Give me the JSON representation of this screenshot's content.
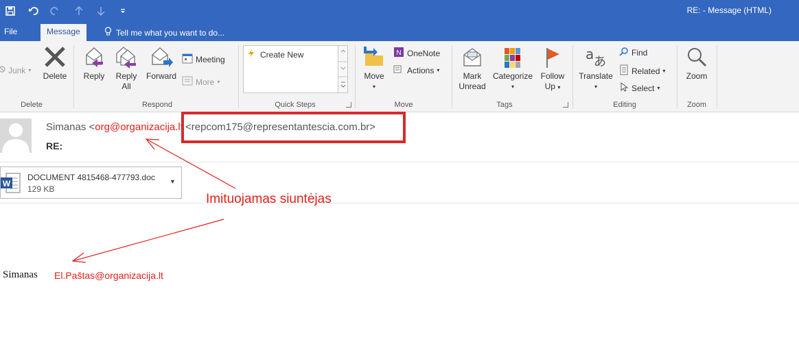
{
  "window": {
    "title": "RE:  - Message (HTML)"
  },
  "tabs": {
    "file": "File",
    "message": "Message",
    "tell_me": "Tell me what you want to do..."
  },
  "ribbon": {
    "delete_group": {
      "junk": "Junk",
      "delete": "Delete",
      "label": "Delete"
    },
    "respond_group": {
      "reply": "Reply",
      "reply_all_line1": "Reply",
      "reply_all_line2": "All",
      "forward": "Forward",
      "meeting": "Meeting",
      "more": "More",
      "label": "Respond"
    },
    "quick_steps_group": {
      "create_new": "Create New",
      "label": "Quick Steps"
    },
    "move_group": {
      "move": "Move",
      "onenote": "OneNote",
      "actions": "Actions",
      "label": "Move"
    },
    "tags_group": {
      "mark_unread_line1": "Mark",
      "mark_unread_line2": "Unread",
      "categorize": "Categorize",
      "follow_up_line1": "Follow",
      "follow_up_line2": "Up",
      "label": "Tags"
    },
    "editing_group": {
      "translate": "Translate",
      "find": "Find",
      "related": "Related",
      "select": "Select",
      "label": "Editing"
    },
    "zoom_group": {
      "zoom": "Zoom",
      "label": "Zoom"
    }
  },
  "message": {
    "sender_name": "Simanas <",
    "sender_display_email": "org@organizacija.lt",
    "real_sender": "<repcom175@representantescia.com.br>",
    "subject": "RE:"
  },
  "attachment": {
    "name": "DOCUMENT 4815468-477793.doc",
    "size": "129 KB"
  },
  "annotation": {
    "text": "Imituojamas siuntėjas"
  },
  "body": {
    "signature_name": "Simanas",
    "signature_email": "El.Paštas@organizacija.lt"
  },
  "colors": {
    "title_bar": "#3467bf",
    "ribbon_bg": "#f3f3f3",
    "highlight_red": "#d52b2b",
    "annotation_red": "#e0201b"
  }
}
